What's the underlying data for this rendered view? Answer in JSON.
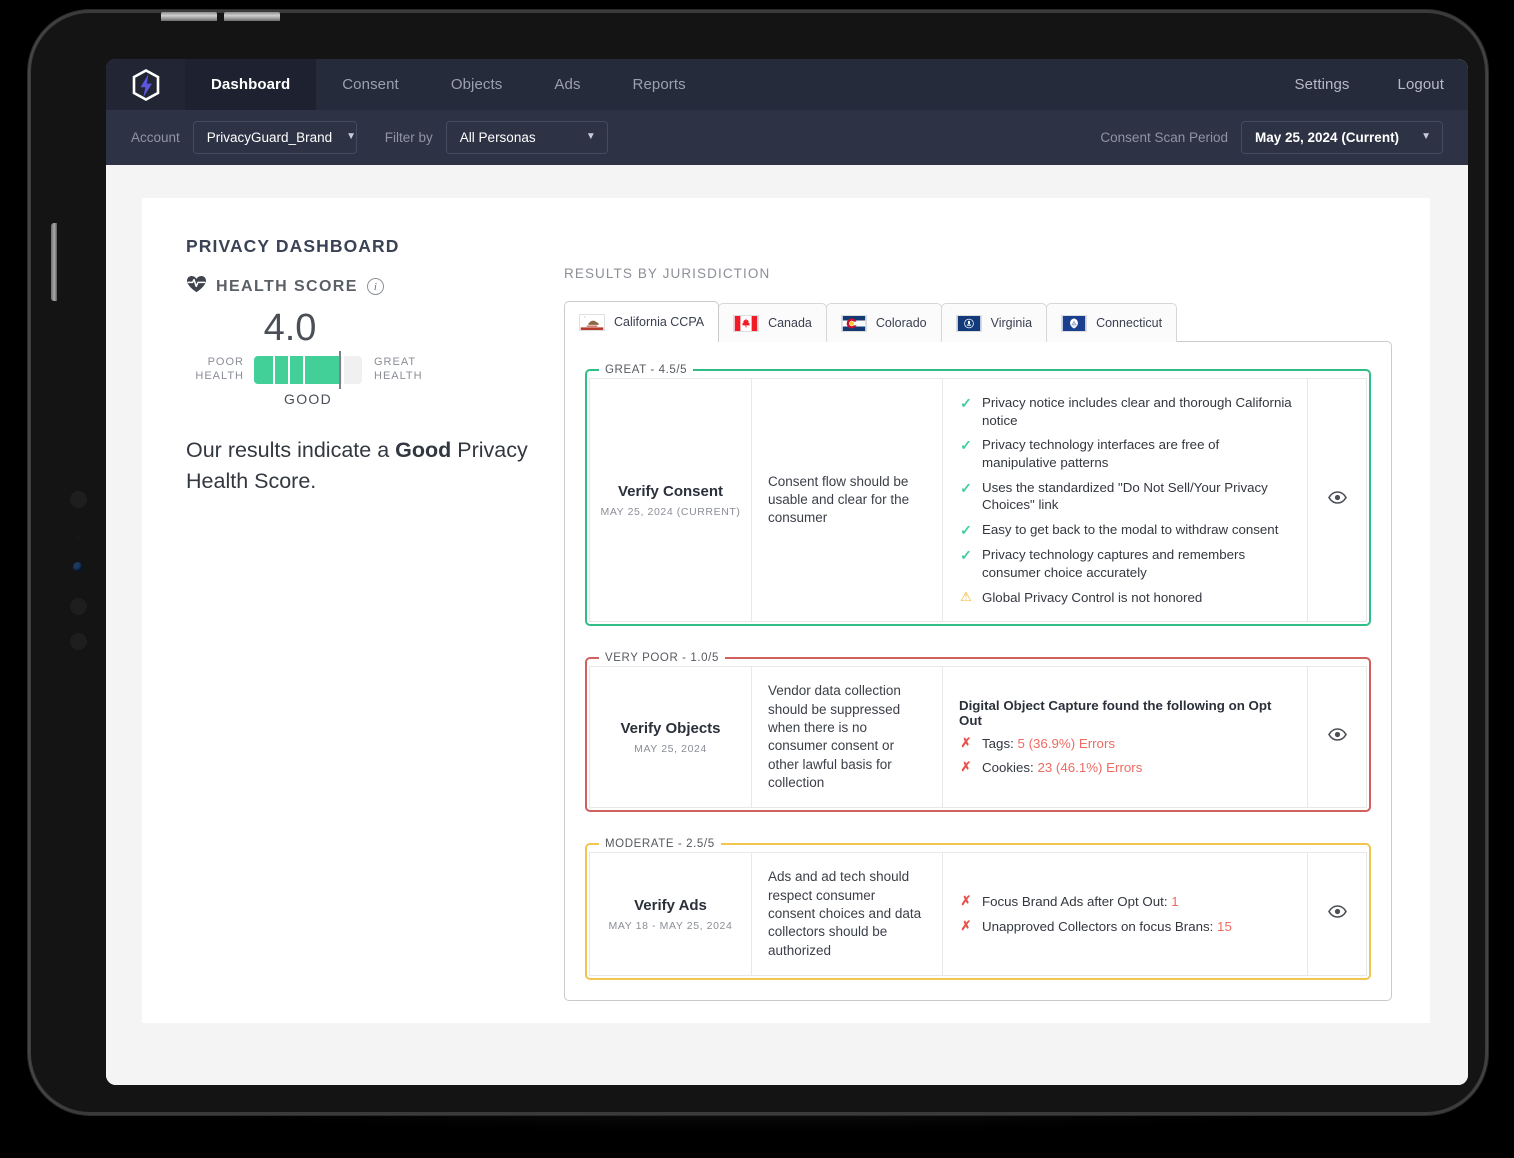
{
  "nav": {
    "logo_icon": "shield-bolt-logo",
    "items": [
      {
        "label": "Dashboard",
        "active": true
      },
      {
        "label": "Consent",
        "active": false
      },
      {
        "label": "Objects",
        "active": false
      },
      {
        "label": "Ads",
        "active": false
      },
      {
        "label": "Reports",
        "active": false
      }
    ],
    "right_items": [
      {
        "label": "Settings"
      },
      {
        "label": "Logout"
      }
    ]
  },
  "subbar": {
    "account_label": "Account",
    "account_value": "PrivacyGuard_Brand",
    "filter_label": "Filter by",
    "filter_value": "All Personas",
    "period_label": "Consent Scan Period",
    "period_value": "May 25, 2024 (Current)",
    "chevron_icon": "chevron-down-icon"
  },
  "dashboard": {
    "title": "PRIVACY DASHBOARD",
    "health_icon": "heart-pulse-icon",
    "health_label": "HEALTH SCORE",
    "info_icon": "info-icon",
    "score": "4.0",
    "gauge_left": "POOR\nHEALTH",
    "gauge_left_line1": "POOR",
    "gauge_left_line2": "HEALTH",
    "gauge_right_line1": "GREAT",
    "gauge_right_line2": "HEALTH",
    "rating_word": "GOOD",
    "summary_pre": "Our results indicate a ",
    "summary_bold": "Good",
    "summary_post": " Privacy Health Score.",
    "accent_green": "#43cf98"
  },
  "results": {
    "section_title": "RESULTS BY JURISDICTION",
    "tabs": [
      {
        "label": "California CCPA",
        "flag": "flag-california",
        "active": true
      },
      {
        "label": "Canada",
        "flag": "flag-canada",
        "active": false
      },
      {
        "label": "Colorado",
        "flag": "flag-colorado",
        "active": false
      },
      {
        "label": "Virginia",
        "flag": "flag-virginia",
        "active": false
      },
      {
        "label": "Connecticut",
        "flag": "flag-connecticut",
        "active": false
      }
    ],
    "cards": [
      {
        "legend": "GREAT - 4.5/5",
        "status": "great",
        "border_color": "#2fbf86",
        "name": "Verify Consent",
        "date": "MAY 25, 2024 (CURRENT)",
        "description": "Consent flow should be usable and clear for the consumer",
        "heading": "",
        "items": [
          {
            "icon": "check",
            "text": "Privacy notice includes clear and thorough California notice"
          },
          {
            "icon": "check",
            "text": "Privacy technology interfaces are free of manipulative patterns"
          },
          {
            "icon": "check",
            "text": "Uses the standardized \"Do Not Sell/Your Privacy Choices\" link"
          },
          {
            "icon": "check",
            "text": "Easy to get back to the modal to withdraw consent"
          },
          {
            "icon": "check",
            "text": "Privacy technology captures and remembers consumer choice accurately"
          },
          {
            "icon": "warn",
            "text": "Global Privacy Control is not honored"
          }
        ],
        "eye_icon": "eye-icon"
      },
      {
        "legend": "VERY POOR - 1.0/5",
        "status": "poor",
        "border_color": "#d0615f",
        "name": "Verify Objects",
        "date": "MAY 25, 2024",
        "description": "Vendor data collection should be suppressed when there is no consumer consent or other lawful basis for collection",
        "heading": "Digital Object Capture found the following on Opt Out",
        "items": [
          {
            "icon": "x",
            "text": "Tags: ",
            "value": "5 (36.9%) Errors",
            "value_is_error": true
          },
          {
            "icon": "x",
            "text": "Cookies: ",
            "value": "23 (46.1%) Errors",
            "value_is_error": true
          }
        ],
        "eye_icon": "eye-icon"
      },
      {
        "legend": "MODERATE - 2.5/5",
        "status": "moderate",
        "border_color": "#f2c551",
        "name": "Verify Ads",
        "date": "MAY 18 - MAY 25, 2024",
        "description": "Ads and ad tech should respect consumer consent choices and data collectors should be authorized",
        "heading": "",
        "items": [
          {
            "icon": "x",
            "text": "Focus Brand Ads after Opt Out: ",
            "value": "1",
            "value_is_error": true
          },
          {
            "icon": "x",
            "text": "Unapproved Collectors on focus Brans: ",
            "value": "15",
            "value_is_error": true
          }
        ],
        "eye_icon": "eye-icon"
      }
    ]
  }
}
